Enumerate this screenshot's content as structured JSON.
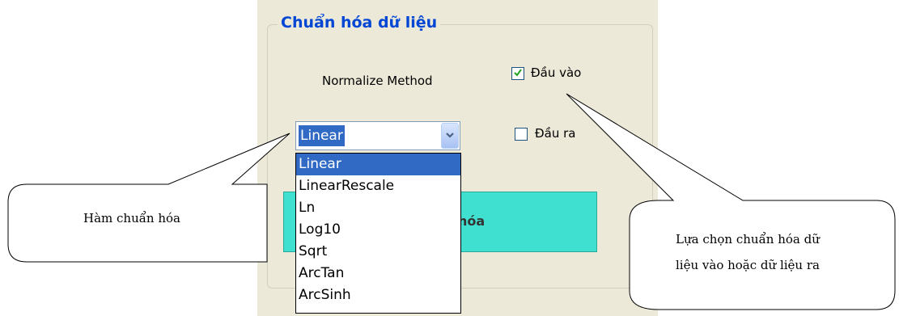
{
  "group": {
    "title": "Chuẩn hóa dữ liệu"
  },
  "normalize": {
    "label": "Normalize Method",
    "selected_value": "Linear",
    "options": [
      "Linear",
      "LinearRescale",
      "Ln",
      "Log10",
      "Sqrt",
      "ArcTan",
      "ArcSinh"
    ]
  },
  "checkboxes": {
    "input_label": "Đầu vào",
    "input_checked": true,
    "output_label": "Đầu ra",
    "output_checked": false
  },
  "action_button": {
    "label_visible": "hóa"
  },
  "callouts": {
    "function": "Hàm chuẩn hóa",
    "selection_line1": "Lựa chọn chuẩn hóa dữ",
    "selection_line2": "liệu vào hoặc dữ liệu ra"
  },
  "colors": {
    "accent_title": "#0046d5",
    "selection": "#316ac5",
    "button": "#40e0d0",
    "panel": "#ece9d8"
  },
  "icons": [
    "check-icon",
    "chevron-down-icon"
  ]
}
